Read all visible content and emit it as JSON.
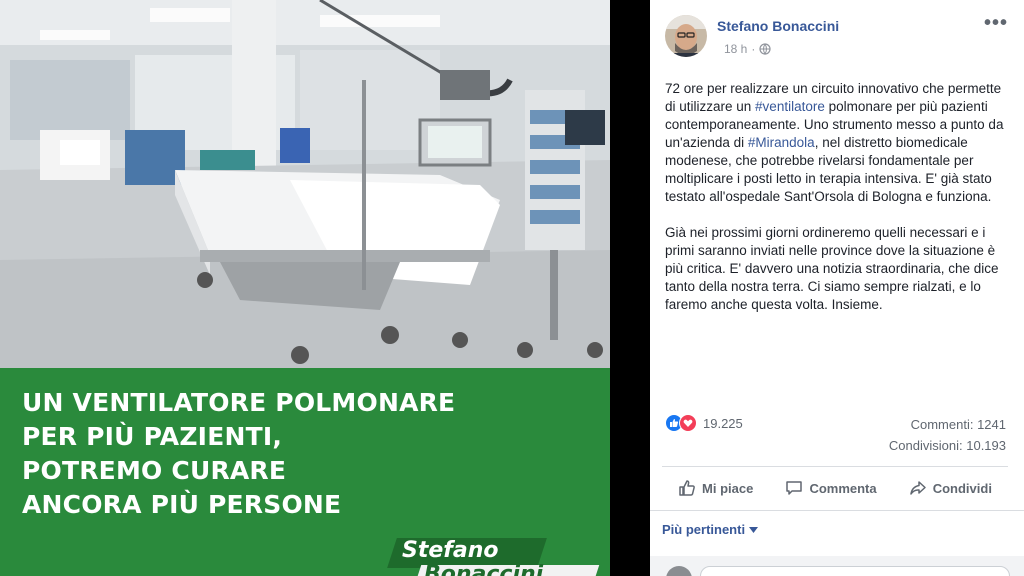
{
  "image": {
    "banner_lines": [
      "UN VENTILATORE POLMONARE",
      "PER PIÙ PAZIENTI,",
      "POTREMO CURARE",
      "ANCORA PIÙ PERSONE"
    ],
    "signature_line1": "Stefano",
    "signature_line2": "Bonaccini",
    "colors": {
      "banner": "#2a8a3c",
      "signature_dark": "#1e6b2c"
    }
  },
  "post": {
    "author": "Stefano Bonaccini",
    "time": "18 h",
    "privacy_icon": "globe-icon",
    "menu_icon": "more-options-icon",
    "paragraph1": {
      "part1": "72 ore per realizzare un circuito innovativo che permette di utilizzare un ",
      "link1": "#ventilatore",
      "part2": " polmonare per più pazienti contemporaneamente. Uno strumento messo a punto da un'azienda di ",
      "link2": "#Mirandola",
      "part3": ", nel distretto biomedicale modenese, che potrebbe rivelarsi fondamentale per moltiplicare i posti letto in terapia intensiva. E' già stato testato all'ospedale Sant'Orsola di Bologna e funziona."
    },
    "paragraph2": "Già nei prossimi giorni ordineremo quelli necessari e i primi saranno inviati nelle province dove la situazione è più critica. E' davvero una notizia straordinaria, che dice tanto della nostra terra. Ci siamo sempre rialzati, e lo faremo anche questa volta. Insieme.",
    "reactions_count": "19.225",
    "comments_label": "Commenti: 1241",
    "shares_label": "Condivisioni: 10.193",
    "actions": {
      "like": "Mi piace",
      "comment": "Commenta",
      "share": "Condividi"
    },
    "sort_label": "Più pertinenti",
    "colors": {
      "link": "#385898",
      "text": "#1d2129",
      "muted": "#606770"
    }
  }
}
